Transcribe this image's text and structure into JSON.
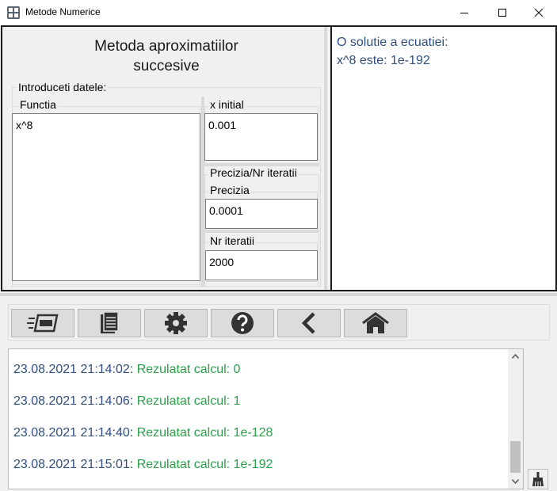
{
  "window": {
    "title": "Metode Numerice"
  },
  "form": {
    "heading_line1": "Metoda aproximatiilor",
    "heading_line2": "succesive",
    "input_group_label": "Introduceti datele:",
    "function_label": "Functia",
    "function_value": "x^8",
    "x_initial_label": "x initial",
    "x_initial_value": "0.001",
    "precision_group_label": "Precizia/Nr iteratii",
    "precision_label": "Precizia",
    "precision_value": "0.0001",
    "iterations_label": "Nr iteratii",
    "iterations_value": "2000"
  },
  "result": {
    "line1": "O solutie a ecuatiei:",
    "line2": "x^8 este: 1e-192"
  },
  "toolbar": {
    "buttons": [
      {
        "icon": "run-icon",
        "action": "calculate"
      },
      {
        "icon": "document-icon",
        "action": "report"
      },
      {
        "icon": "gear-icon",
        "action": "settings"
      },
      {
        "icon": "help-icon",
        "action": "help"
      },
      {
        "icon": "back-icon",
        "action": "back"
      },
      {
        "icon": "home-icon",
        "action": "home"
      }
    ]
  },
  "log": {
    "entries": [
      {
        "timestamp": "23.08.2021 21:14:02:",
        "message": "Rezulatat calcul: 0"
      },
      {
        "timestamp": "23.08.2021 21:14:06:",
        "message": "Rezulatat calcul: 1"
      },
      {
        "timestamp": "23.08.2021 21:14:40:",
        "message": "Rezulatat calcul: 1e-128"
      },
      {
        "timestamp": "23.08.2021 21:15:01:",
        "message": "Rezulatat calcul: 1e-192"
      }
    ],
    "clear_icon": "broom-icon"
  },
  "colors": {
    "timestamp": "#2f4f7f",
    "message": "#2aa24a",
    "result_text": "#2f4f7f",
    "button_bg": "#dcdcdc",
    "icon": "#333333"
  }
}
